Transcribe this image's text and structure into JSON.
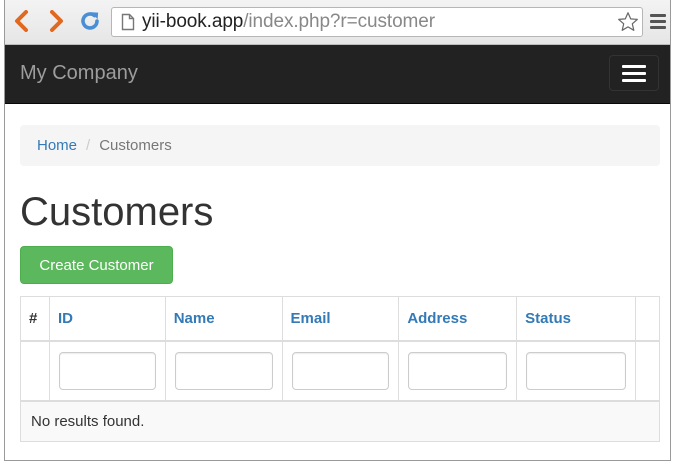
{
  "browser": {
    "url_host": "yii-book.app",
    "url_path": "/index.php?r=customer"
  },
  "navbar": {
    "brand": "My Company"
  },
  "breadcrumb": {
    "items": [
      {
        "label": "Home"
      },
      {
        "label": "Customers"
      }
    ],
    "separator": "/"
  },
  "page": {
    "title": "Customers",
    "create_button": "Create Customer"
  },
  "grid": {
    "columns": [
      {
        "label": "#"
      },
      {
        "label": "ID"
      },
      {
        "label": "Name"
      },
      {
        "label": "Email"
      },
      {
        "label": "Address"
      },
      {
        "label": "Status"
      },
      {
        "label": ""
      }
    ],
    "filters": {
      "id": "",
      "name": "",
      "email": "",
      "address": "",
      "status": ""
    },
    "empty_text": "No results found."
  },
  "colors": {
    "navbar_bg": "#222222",
    "brand_text": "#9d9d9d",
    "link": "#337ab7",
    "success_button": "#5cb85c"
  },
  "icons": {
    "back": "chevron-left-icon",
    "forward": "chevron-right-icon",
    "reload": "reload-icon",
    "page": "page-icon",
    "bookmark": "star-icon",
    "browser_menu": "hamburger-menu-icon",
    "navbar_toggle": "hamburger-menu-icon"
  }
}
